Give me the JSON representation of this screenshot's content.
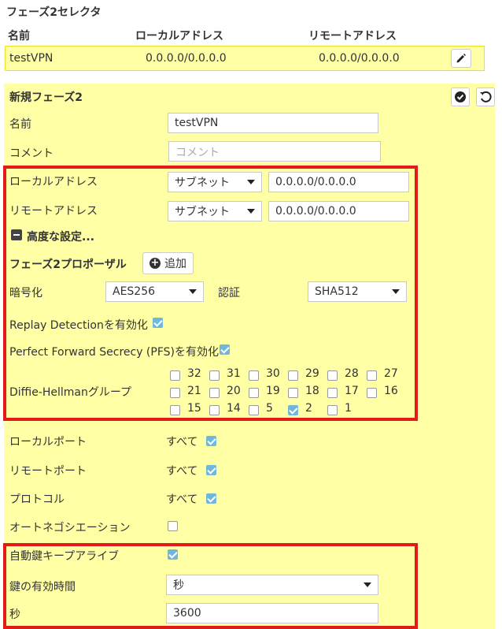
{
  "selector": {
    "title": "フェーズ2セレクタ",
    "col_name": "名前",
    "col_local": "ローカルアドレス",
    "col_remote": "リモートアドレス",
    "row": {
      "name": "testVPN",
      "local": "0.0.0.0/0.0.0.0",
      "remote": "0.0.0.0/0.0.0.0"
    }
  },
  "form": {
    "heading": "新規フェーズ2",
    "name_label": "名前",
    "name_value": "testVPN",
    "comment_label": "コメント",
    "comment_placeholder": "コメント",
    "local_addr_label": "ローカルアドレス",
    "local_addr_type": "サブネット",
    "local_addr_value": "0.0.0.0/0.0.0.0",
    "remote_addr_label": "リモートアドレス",
    "remote_addr_type": "サブネット",
    "remote_addr_value": "0.0.0.0/0.0.0.0",
    "advanced_label": "高度な設定...",
    "proposal_label": "フェーズ2プロポーザル",
    "add_label": "追加",
    "encryption_label": "暗号化",
    "encryption_value": "AES256",
    "auth_label": "認証",
    "auth_value": "SHA512",
    "replay_label": "Replay Detectionを有効化",
    "replay_checked": true,
    "pfs_label": "Perfect Forward Secrecy (PFS)を有効化",
    "pfs_checked": true,
    "dh_label": "Diffie-Hellmanグループ",
    "dh_groups": [
      {
        "n": "32",
        "checked": false
      },
      {
        "n": "31",
        "checked": false
      },
      {
        "n": "30",
        "checked": false
      },
      {
        "n": "29",
        "checked": false
      },
      {
        "n": "28",
        "checked": false
      },
      {
        "n": "27",
        "checked": false
      },
      {
        "n": "21",
        "checked": false
      },
      {
        "n": "20",
        "checked": false
      },
      {
        "n": "19",
        "checked": false
      },
      {
        "n": "18",
        "checked": false
      },
      {
        "n": "17",
        "checked": false
      },
      {
        "n": "16",
        "checked": false
      },
      {
        "n": "15",
        "checked": false
      },
      {
        "n": "14",
        "checked": false
      },
      {
        "n": "5",
        "checked": false
      },
      {
        "n": "2",
        "checked": true
      },
      {
        "n": "1",
        "checked": false
      }
    ],
    "local_port_label": "ローカルポート",
    "local_port_value": "すべて",
    "remote_port_label": "リモートポート",
    "remote_port_value": "すべて",
    "protocol_label": "プロトコル",
    "protocol_value": "すべて",
    "autoneg_label": "オートネゴシエーション",
    "autokey_label": "自動鍵キープアライブ",
    "key_lifetime_label": "鍵の有効時間",
    "key_lifetime_value": "秒",
    "seconds_label": "秒",
    "seconds_value": "3600"
  },
  "colors": {
    "panel": "#ffffa6",
    "highlight_border": "#e31a1a",
    "checkbox_on": "#6fb8dc"
  },
  "icons": [
    "pencil-icon",
    "check-circle-icon",
    "undo-icon",
    "minus-square-icon",
    "plus-circle-icon",
    "chevron-down-icon"
  ]
}
